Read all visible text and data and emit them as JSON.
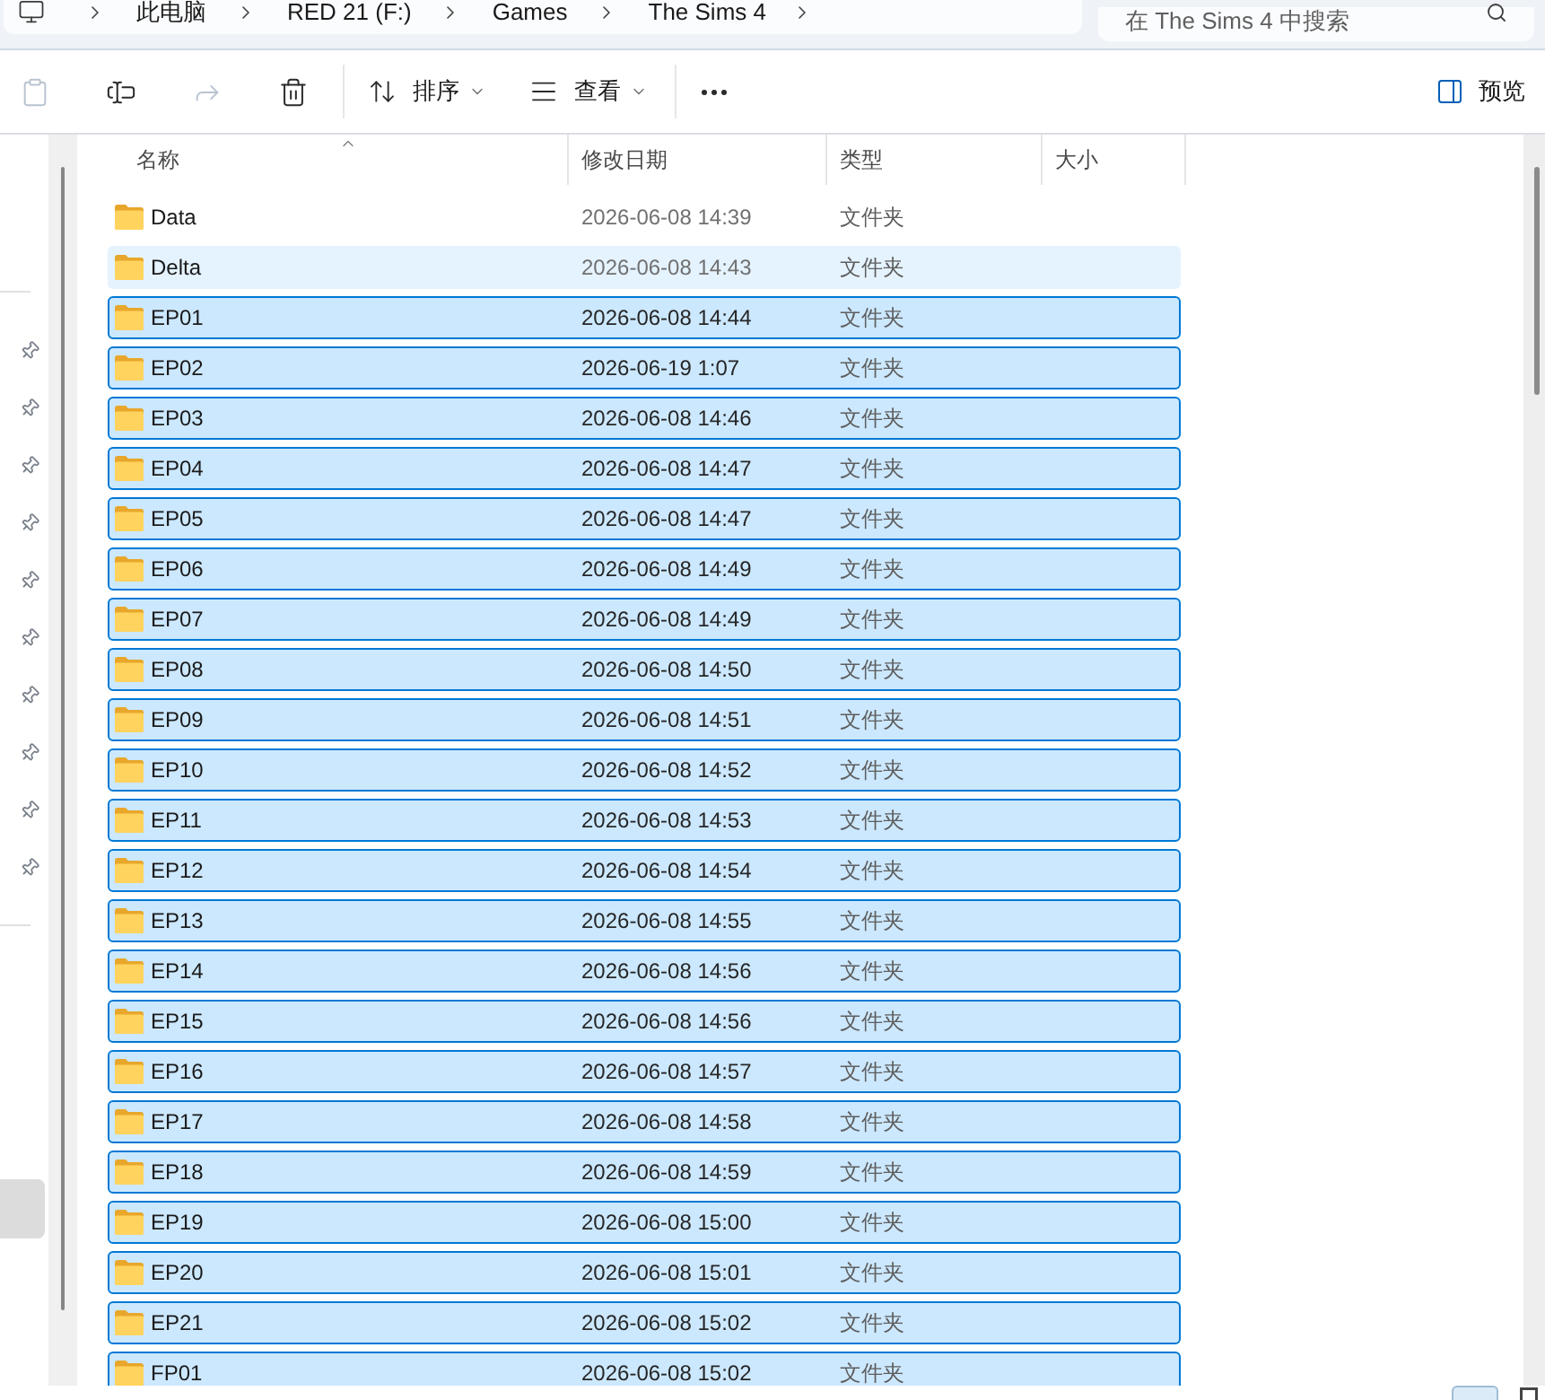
{
  "address_bar": {
    "breadcrumbs": [
      "此电脑",
      "RED 21 (F:)",
      "Games",
      "The Sims 4"
    ]
  },
  "search": {
    "placeholder": "在 The Sims 4 中搜索"
  },
  "toolbar": {
    "actions": [
      {
        "kind": "paste",
        "disabled": true
      },
      {
        "kind": "rename",
        "disabled": false
      },
      {
        "kind": "share",
        "disabled": true
      },
      {
        "kind": "delete",
        "disabled": false
      }
    ],
    "sort": {
      "label": "排序"
    },
    "view": {
      "label": "查看"
    },
    "preview": {
      "label": "预览"
    }
  },
  "nav_pane": {
    "pinned_items": [
      {
        "pinned": true
      },
      {
        "pinned": true
      },
      {
        "pinned": true
      },
      {
        "pinned": true
      },
      {
        "pinned": true
      },
      {
        "pinned": true
      },
      {
        "pinned": true
      },
      {
        "pinned": true
      },
      {
        "pinned": true
      },
      {
        "pinned": true
      }
    ],
    "selected_item": {
      "selected": true
    }
  },
  "file_list": {
    "columns": [
      {
        "label": "名称",
        "sorted_ascending": true
      },
      {
        "label": "修改日期",
        "sorted_ascending": false
      },
      {
        "label": "类型",
        "sorted_ascending": false
      },
      {
        "label": "大小",
        "sorted_ascending": false
      }
    ],
    "rows": [
      {
        "name": "Data",
        "modified": "2026-06-08 14:39",
        "type": "文件夹",
        "selected": false,
        "hovered": false
      },
      {
        "name": "Delta",
        "modified": "2026-06-08 14:43",
        "type": "文件夹",
        "selected": false,
        "hovered": true
      },
      {
        "name": "EP01",
        "modified": "2026-06-08 14:44",
        "type": "文件夹",
        "selected": true,
        "hovered": false
      },
      {
        "name": "EP02",
        "modified": "2026-06-19 1:07",
        "type": "文件夹",
        "selected": true,
        "hovered": false
      },
      {
        "name": "EP03",
        "modified": "2026-06-08 14:46",
        "type": "文件夹",
        "selected": true,
        "hovered": false
      },
      {
        "name": "EP04",
        "modified": "2026-06-08 14:47",
        "type": "文件夹",
        "selected": true,
        "hovered": false
      },
      {
        "name": "EP05",
        "modified": "2026-06-08 14:47",
        "type": "文件夹",
        "selected": true,
        "hovered": false
      },
      {
        "name": "EP06",
        "modified": "2026-06-08 14:49",
        "type": "文件夹",
        "selected": true,
        "hovered": false
      },
      {
        "name": "EP07",
        "modified": "2026-06-08 14:49",
        "type": "文件夹",
        "selected": true,
        "hovered": false
      },
      {
        "name": "EP08",
        "modified": "2026-06-08 14:50",
        "type": "文件夹",
        "selected": true,
        "hovered": false
      },
      {
        "name": "EP09",
        "modified": "2026-06-08 14:51",
        "type": "文件夹",
        "selected": true,
        "hovered": false
      },
      {
        "name": "EP10",
        "modified": "2026-06-08 14:52",
        "type": "文件夹",
        "selected": true,
        "hovered": false
      },
      {
        "name": "EP11",
        "modified": "2026-06-08 14:53",
        "type": "文件夹",
        "selected": true,
        "hovered": false
      },
      {
        "name": "EP12",
        "modified": "2026-06-08 14:54",
        "type": "文件夹",
        "selected": true,
        "hovered": false
      },
      {
        "name": "EP13",
        "modified": "2026-06-08 14:55",
        "type": "文件夹",
        "selected": true,
        "hovered": false
      },
      {
        "name": "EP14",
        "modified": "2026-06-08 14:56",
        "type": "文件夹",
        "selected": true,
        "hovered": false
      },
      {
        "name": "EP15",
        "modified": "2026-06-08 14:56",
        "type": "文件夹",
        "selected": true,
        "hovered": false
      },
      {
        "name": "EP16",
        "modified": "2026-06-08 14:57",
        "type": "文件夹",
        "selected": true,
        "hovered": false
      },
      {
        "name": "EP17",
        "modified": "2026-06-08 14:58",
        "type": "文件夹",
        "selected": true,
        "hovered": false
      },
      {
        "name": "EP18",
        "modified": "2026-06-08 14:59",
        "type": "文件夹",
        "selected": true,
        "hovered": false
      },
      {
        "name": "EP19",
        "modified": "2026-06-08 15:00",
        "type": "文件夹",
        "selected": true,
        "hovered": false
      },
      {
        "name": "EP20",
        "modified": "2026-06-08 15:01",
        "type": "文件夹",
        "selected": true,
        "hovered": false
      },
      {
        "name": "EP21",
        "modified": "2026-06-08 15:02",
        "type": "文件夹",
        "selected": true,
        "hovered": false
      },
      {
        "name": "FP01",
        "modified": "2026-06-08 15:02",
        "type": "文件夹",
        "selected": true,
        "hovered": false
      }
    ]
  },
  "status_bar": {
    "view_buttons": [
      {
        "kind": "details",
        "selected": true
      },
      {
        "kind": "tiles",
        "selected": false
      }
    ]
  }
}
